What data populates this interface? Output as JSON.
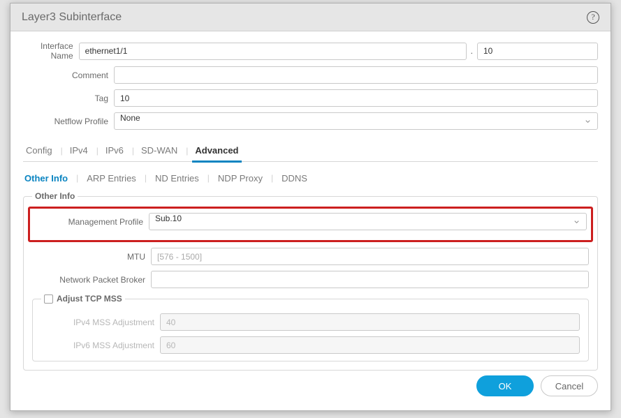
{
  "dialog": {
    "title": "Layer3 Subinterface"
  },
  "fields": {
    "interface_name_label": "Interface Name",
    "interface_name_value": "ethernet1/1",
    "interface_sub_value": "10",
    "interface_dot": ".",
    "comment_label": "Comment",
    "comment_value": "",
    "tag_label": "Tag",
    "tag_value": "10",
    "netflow_label": "Netflow Profile",
    "netflow_value": "None"
  },
  "tabs": {
    "items": [
      "Config",
      "IPv4",
      "IPv6",
      "SD-WAN",
      "Advanced"
    ],
    "active_index": 4
  },
  "subtabs": {
    "items": [
      "Other Info",
      "ARP Entries",
      "ND Entries",
      "NDP Proxy",
      "DDNS"
    ],
    "active_index": 0
  },
  "other_info": {
    "group_label": "Other Info",
    "mgmt_profile_label": "Management Profile",
    "mgmt_profile_value": "Sub.10",
    "mtu_label": "MTU",
    "mtu_placeholder": "[576 - 1500]",
    "mtu_value": "",
    "npb_label": "Network Packet Broker",
    "npb_value": ""
  },
  "tcp_mss": {
    "legend": "Adjust TCP MSS",
    "checked": false,
    "ipv4_label": "IPv4 MSS Adjustment",
    "ipv4_value": "40",
    "ipv6_label": "IPv6 MSS Adjustment",
    "ipv6_value": "60"
  },
  "buttons": {
    "ok": "OK",
    "cancel": "Cancel"
  }
}
